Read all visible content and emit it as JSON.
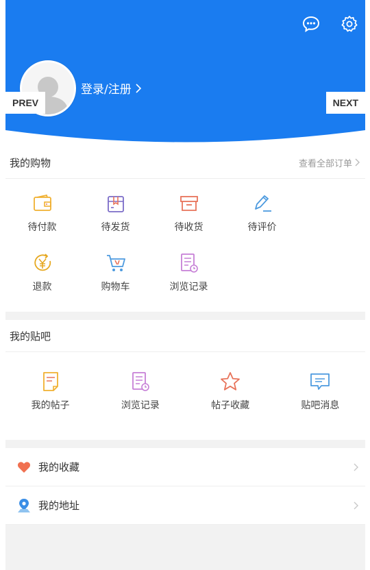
{
  "header": {
    "login_text": "登录/注册",
    "prev_label": "PREV",
    "next_label": "NEXT",
    "colors": {
      "brand_blue": "#1a7cf0"
    },
    "icons": [
      "chat-icon",
      "gear-icon",
      "avatar-placeholder",
      "chevron-right-icon"
    ]
  },
  "shopping": {
    "title": "我的购物",
    "more": "查看全部订单",
    "items": [
      {
        "label": "待付款",
        "icon": "wallet-icon",
        "color": "#f0b030"
      },
      {
        "label": "待发货",
        "icon": "package-icon",
        "color": "#7b6cc8"
      },
      {
        "label": "待收货",
        "icon": "box-icon",
        "color": "#e8735a"
      },
      {
        "label": "待评价",
        "icon": "pencil-icon",
        "color": "#4c9adf"
      },
      {
        "label": "退款",
        "icon": "refund-yen-icon",
        "color": "#e6a820"
      },
      {
        "label": "购物车",
        "icon": "cart-icon",
        "color": "#4c9adf"
      },
      {
        "label": "浏览记录",
        "icon": "history-list-icon",
        "color": "#c67fd6"
      }
    ]
  },
  "tieba": {
    "title": "我的贴吧",
    "items": [
      {
        "label": "我的帖子",
        "icon": "note-icon",
        "color": "#f0b030"
      },
      {
        "label": "浏览记录",
        "icon": "history-list-icon",
        "color": "#c67fd6"
      },
      {
        "label": "帖子收藏",
        "icon": "star-icon",
        "color": "#e8735a"
      },
      {
        "label": "贴吧消息",
        "icon": "message-icon",
        "color": "#4c9adf"
      }
    ]
  },
  "list": [
    {
      "label": "我的收藏",
      "icon": "heart-icon",
      "color": "#f07050"
    },
    {
      "label": "我的地址",
      "icon": "location-pin-icon",
      "color": "#3a8ee6"
    }
  ]
}
